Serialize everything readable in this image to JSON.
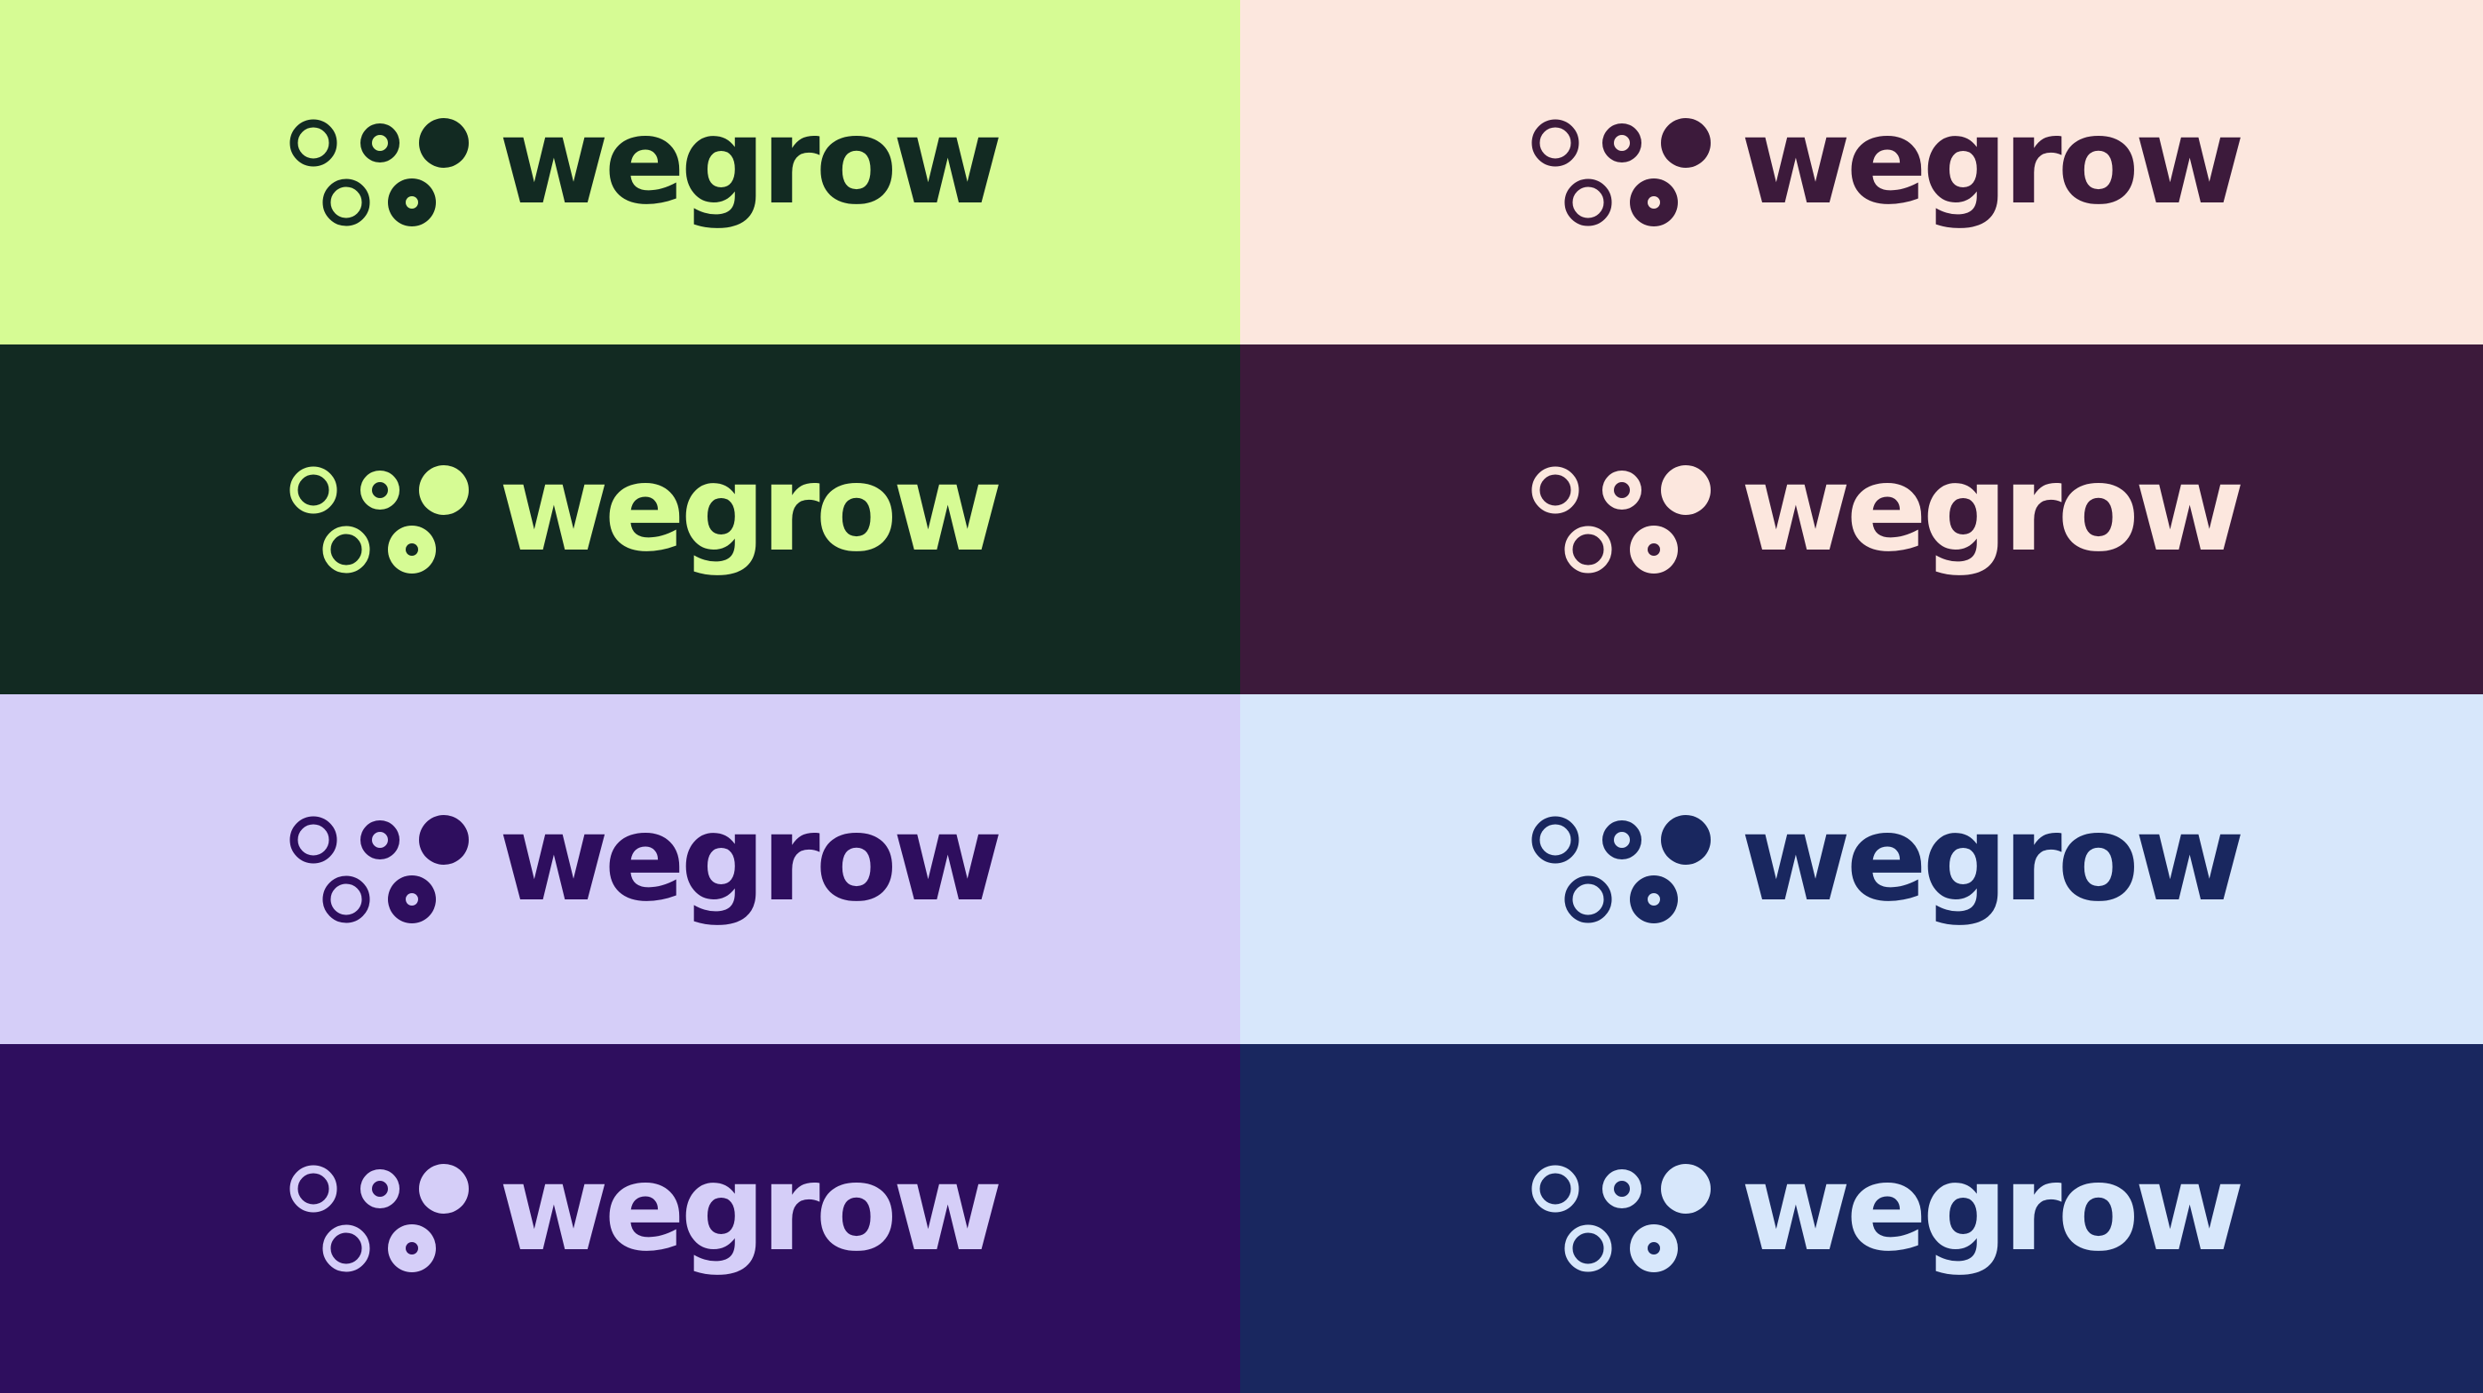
{
  "brand": {
    "name": "wegrow",
    "mark_icon": "cluster-of-circles-logo-icon"
  },
  "tiles": [
    {
      "background": "#D6FB94",
      "foreground": "#122A22"
    },
    {
      "background": "#FCE7DE",
      "foreground": "#3C1A3B"
    },
    {
      "background": "#122A22",
      "foreground": "#D6FB94"
    },
    {
      "background": "#3C1A3B",
      "foreground": "#FCE7DE"
    },
    {
      "background": "#D5CEF8",
      "foreground": "#2E0E5E"
    },
    {
      "background": "#D7E7FB",
      "foreground": "#19275F"
    },
    {
      "background": "#2E0E5E",
      "foreground": "#D5CEF8"
    },
    {
      "background": "#19275F",
      "foreground": "#D7E7FB"
    }
  ]
}
